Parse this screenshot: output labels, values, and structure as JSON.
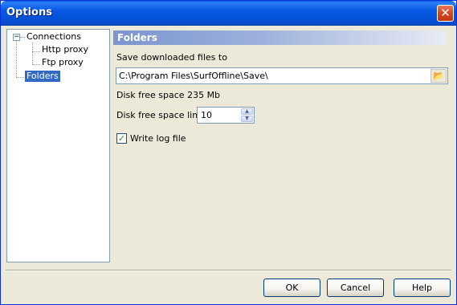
{
  "window": {
    "title": "Options",
    "close_glyph": "✕"
  },
  "tree": {
    "expander_glyph": "−",
    "items": [
      {
        "label": "Connections"
      },
      {
        "label": "Http proxy"
      },
      {
        "label": "Ftp proxy"
      },
      {
        "label": "Folders",
        "selected": true
      }
    ]
  },
  "panel": {
    "header": "Folders",
    "save_label": "Save downloaded files to",
    "save_path": "C:\\Program Files\\SurfOffline\\Save\\",
    "browse_icon": "open-folder-icon",
    "browse_glyph": "📂",
    "disk_free_text": "Disk free space 235 Mb",
    "limit_label": "Disk free space limit",
    "limit_value": "10",
    "spin_up": "▲",
    "spin_down": "▼",
    "write_log_label": "Write log file",
    "write_log_checked": true,
    "check_glyph": "✓"
  },
  "buttons": {
    "ok": "OK",
    "cancel": "Cancel",
    "help": "Help"
  },
  "colors": {
    "title_bar": "#0758e4",
    "selection": "#316ac5",
    "header_gradient_start": "#7a94cf"
  }
}
